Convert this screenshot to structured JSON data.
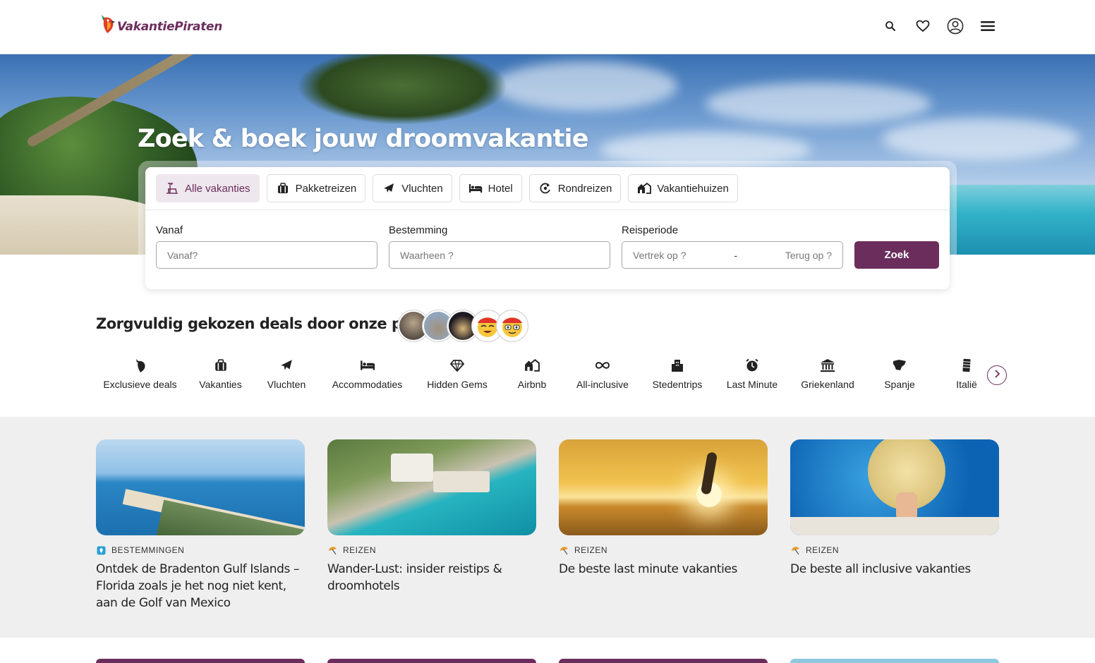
{
  "header": {
    "logo_text": "VakantiePiraten",
    "icons": [
      "search-icon",
      "heart-icon",
      "user-circle-icon",
      "menu-icon"
    ]
  },
  "hero": {
    "title": "Zoek & boek jouw droomvakantie"
  },
  "search": {
    "tabs": [
      {
        "label": "Alle vakanties",
        "icon": "beach-chair-icon",
        "active": true
      },
      {
        "label": "Pakketreizen",
        "icon": "suitcase-icon",
        "active": false
      },
      {
        "label": "Vluchten",
        "icon": "plane-icon",
        "active": false
      },
      {
        "label": "Hotel",
        "icon": "bed-icon",
        "active": false
      },
      {
        "label": "Rondreizen",
        "icon": "round-trip-icon",
        "active": false
      },
      {
        "label": "Vakantiehuizen",
        "icon": "houses-icon",
        "active": false
      }
    ],
    "from_label": "Vanaf",
    "from_placeholder": "Vanaf?",
    "to_label": "Bestemming",
    "to_placeholder": "Waarheen ?",
    "period_label": "Reisperiode",
    "depart_placeholder": "Vertrek op ?",
    "date_separator": "-",
    "return_placeholder": "Terug op ?",
    "submit_label": "Zoek"
  },
  "deals": {
    "title": "Zorgvuldig gekozen deals door onze piraten",
    "categories": [
      {
        "label": "Exclusieve deals",
        "icon": "parrot-icon"
      },
      {
        "label": "Vakanties",
        "icon": "suitcase-icon"
      },
      {
        "label": "Vluchten",
        "icon": "plane-icon"
      },
      {
        "label": "Accommodaties",
        "icon": "bed-icon"
      },
      {
        "label": "Hidden Gems",
        "icon": "diamond-icon"
      },
      {
        "label": "Airbnb",
        "icon": "houses-icon"
      },
      {
        "label": "All-inclusive",
        "icon": "infinity-icon"
      },
      {
        "label": "Stedentrips",
        "icon": "buildings-icon"
      },
      {
        "label": "Last Minute",
        "icon": "alarm-clock-icon"
      },
      {
        "label": "Griekenland",
        "icon": "greek-temple-icon"
      },
      {
        "label": "Spanje",
        "icon": "spain-map-icon"
      },
      {
        "label": "Italië",
        "icon": "pisa-tower-icon"
      }
    ]
  },
  "articles": [
    {
      "category": "BESTEMMINGEN",
      "icon": "map-pin-icon",
      "title": "Ontdek de Bradenton Gulf Islands – Florida zoals je het nog niet kent, aan de Golf van Mexico"
    },
    {
      "category": "REIZEN",
      "icon": "parasol-icon",
      "title": "Wander-Lust: insider reistips & droomhotels"
    },
    {
      "category": "REIZEN",
      "icon": "parasol-icon",
      "title": "De beste last minute vakanties"
    },
    {
      "category": "REIZEN",
      "icon": "parasol-icon",
      "title": "De beste all inclusive vakanties"
    }
  ],
  "colors": {
    "brand": "#6b2d5c",
    "brand_light": "#efe7ee",
    "section_bg": "#efefef"
  }
}
